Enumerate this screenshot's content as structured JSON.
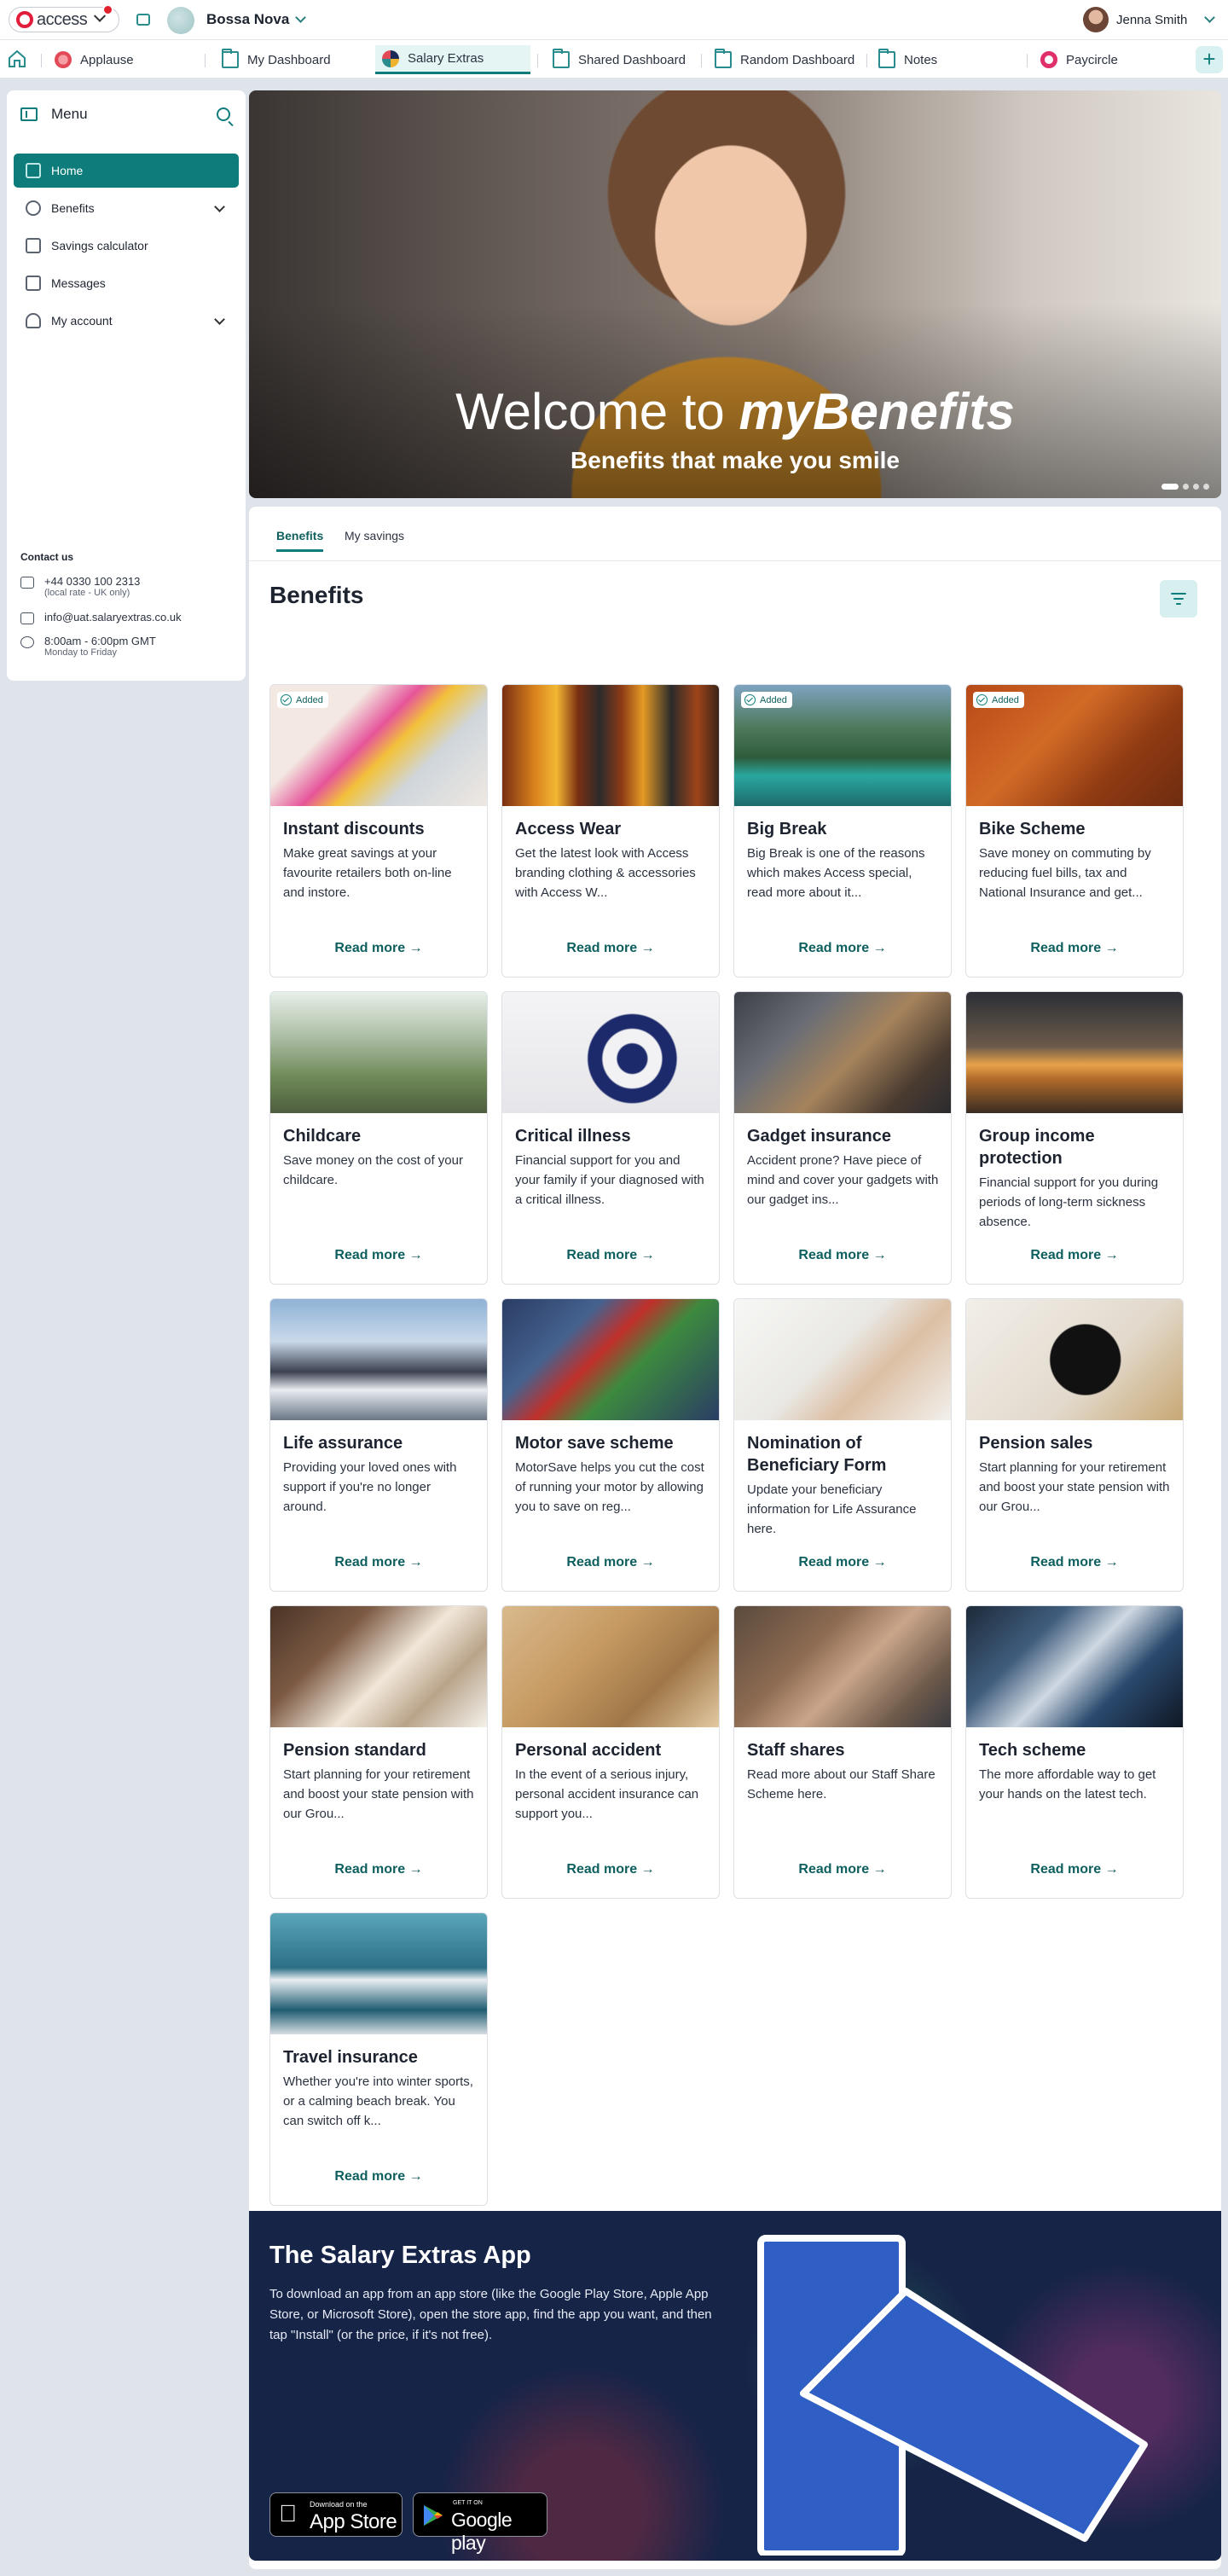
{
  "topbar": {
    "brand": "access",
    "org_name": "Bossa Nova",
    "user_name": "Jenna Smith"
  },
  "tabs": [
    {
      "label": "Applause",
      "icon": "applause-icon"
    },
    {
      "label": "My Dashboard",
      "icon": "folder-icon"
    },
    {
      "label": "Salary Extras",
      "icon": "salary-extras-icon"
    },
    {
      "label": "Shared Dashboard",
      "icon": "folder-icon"
    },
    {
      "label": "Random Dashboard",
      "icon": "folder-icon"
    },
    {
      "label": "Notes",
      "icon": "folder-icon"
    },
    {
      "label": "Paycircle",
      "icon": "paycircle-icon"
    }
  ],
  "add_tab_label": "+",
  "sidebar": {
    "title": "Menu",
    "items": [
      {
        "label": "Home",
        "active": true
      },
      {
        "label": "Benefits",
        "expandable": true
      },
      {
        "label": "Savings calculator"
      },
      {
        "label": "Messages"
      },
      {
        "label": "My account",
        "expandable": true
      }
    ],
    "contact": {
      "title": "Contact us",
      "phone": "+44 0330 100 2313",
      "phone_note": "(local rate - UK only)",
      "email": "info@uat.salaryextras.co.uk",
      "hours": "8:00am - 6:00pm GMT",
      "days": "Monday to Friday"
    }
  },
  "hero": {
    "title_prefix": "Welcome to ",
    "title_brand": "myBenefits",
    "subtitle": "Benefits that make you smile"
  },
  "subtabs": [
    "Benefits",
    "My savings"
  ],
  "section_title": "Benefits",
  "badge_label": "Added",
  "read_more_label": "Read more",
  "cards": [
    {
      "title": "Instant discounts",
      "desc": "Make great savings at your favourite retailers both on-line and instore.",
      "added": true
    },
    {
      "title": "Access Wear",
      "desc": "Get the latest look with Access branding clothing & accessories with Access W...",
      "added": false
    },
    {
      "title": "Big Break",
      "desc": "Big Break is one of the reasons which makes Access special, read more about it...",
      "added": true
    },
    {
      "title": "Bike Scheme",
      "desc": "Save money on commuting by reducing fuel bills, tax and National Insurance and get...",
      "added": true
    },
    {
      "title": "Childcare",
      "desc": "Save money on the cost of your childcare.",
      "added": false
    },
    {
      "title": "Critical illness",
      "desc": "Financial support for you and your family if your diagnosed with a critical illness.",
      "added": false
    },
    {
      "title": "Gadget insurance",
      "desc": "Accident prone? Have piece of mind and cover your gadgets with our gadget ins...",
      "added": false
    },
    {
      "title": "Group income protection",
      "desc": "Financial support for you during periods of long-term sickness absence.",
      "added": false
    },
    {
      "title": "Life assurance",
      "desc": "Providing your loved ones with support if you're no longer around.",
      "added": false
    },
    {
      "title": "Motor save scheme",
      "desc": "MotorSave helps you cut the cost of running your motor by allowing you to save on reg...",
      "added": false
    },
    {
      "title": "Nomination of Beneficiary Form",
      "desc": "Update your beneficiary information for Life Assurance here.",
      "added": false
    },
    {
      "title": "Pension sales",
      "desc": "Start planning for your retirement and boost your state pension with our Grou...",
      "added": false
    },
    {
      "title": "Pension standard",
      "desc": "Start planning for your retirement and boost your state pension with our Grou...",
      "added": false
    },
    {
      "title": "Personal accident",
      "desc": "In the event of a serious injury, personal accident insurance can support you...",
      "added": false
    },
    {
      "title": "Staff shares",
      "desc": "Read more about our Staff Share Scheme here.",
      "added": false
    },
    {
      "title": "Tech scheme",
      "desc": "The more affordable way to get your hands on the latest tech.",
      "added": false
    },
    {
      "title": "Travel insurance",
      "desc": "Whether you're into winter sports, or a calming beach break. You can switch off k...",
      "added": false
    }
  ],
  "app": {
    "title": "The Salary Extras App",
    "desc": "To download an app from an app store (like the Google Play Store, Apple App Store, or Microsoft Store), open the store app, find the app you want, and then tap \"Install\" (or the price, if it's not free).",
    "apple_small": "Download on the",
    "apple_big": "App Store",
    "google_small": "GET IT ON",
    "google_big": "Google play"
  },
  "colors": {
    "accent": "#0e7c7a",
    "banner": "#162448",
    "logo_blue": "#2f5fc4"
  }
}
